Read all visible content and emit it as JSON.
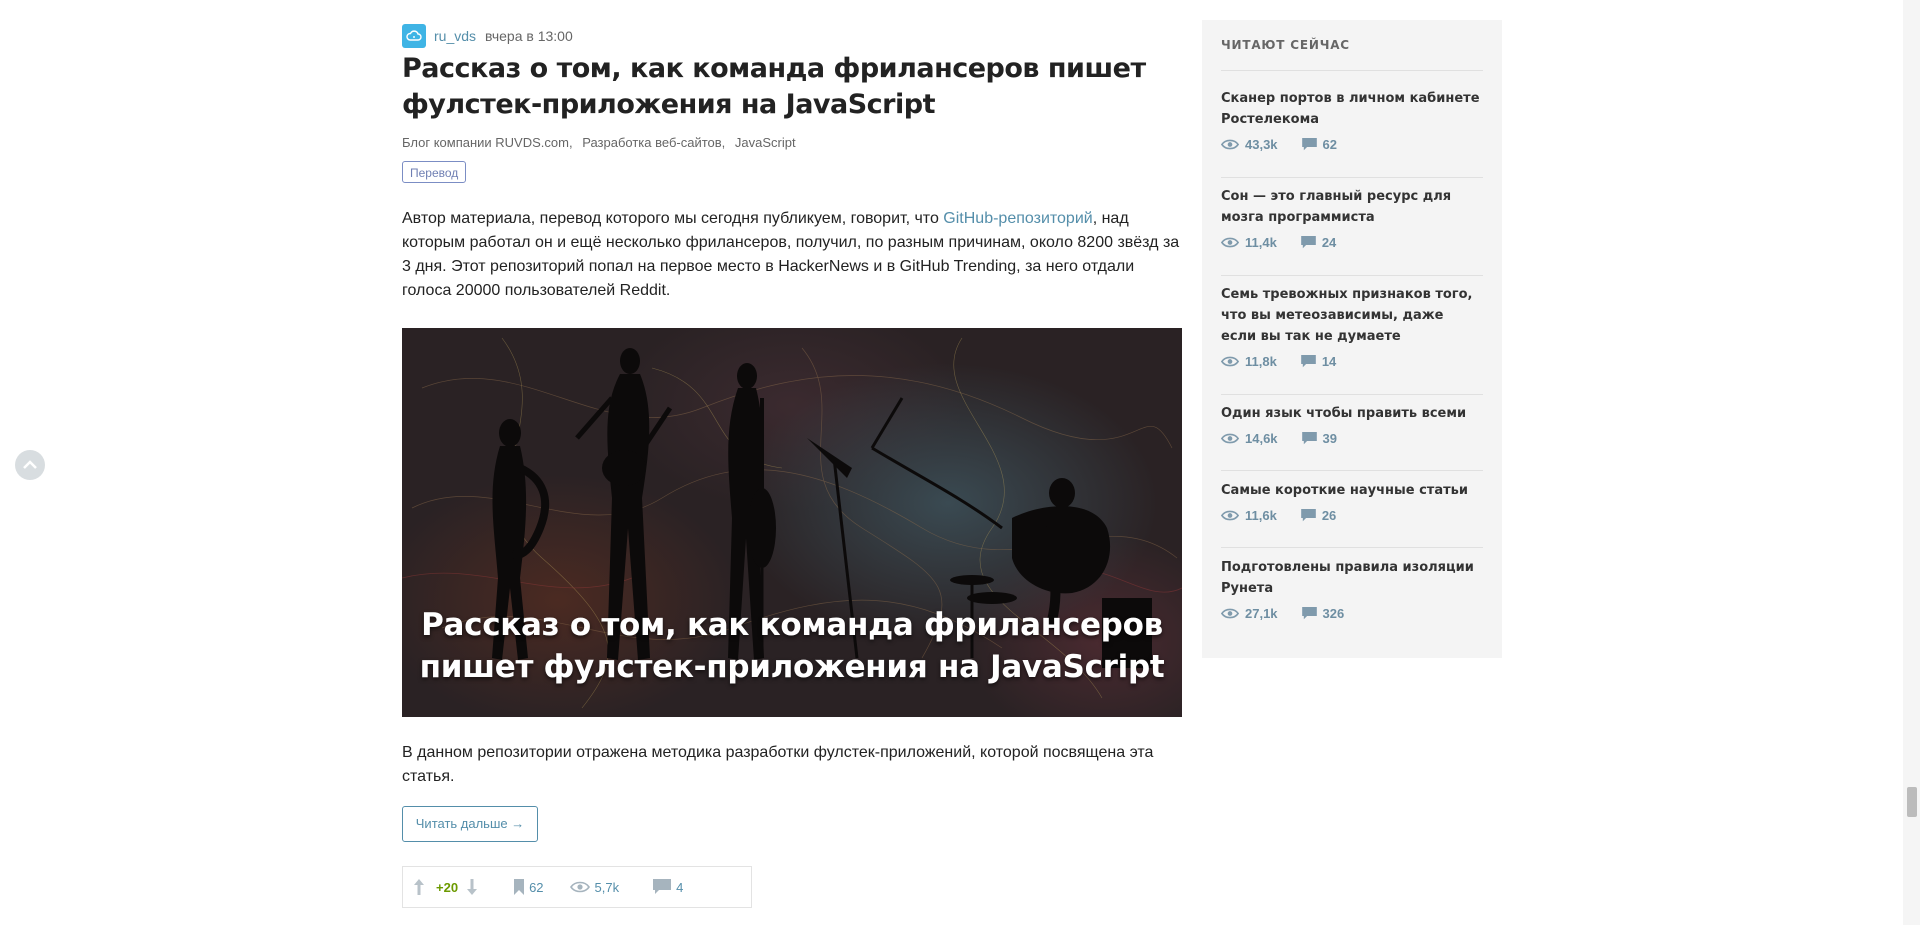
{
  "post": {
    "author": "ru_vds",
    "time": "вчера в 13:00",
    "title": "Рассказ о том, как команда фрилансеров пишет фулстек-приложения на JavaScript",
    "hubs": [
      "Блог компании RUVDS.com,",
      "Разработка веб-сайтов,",
      "JavaScript"
    ],
    "badge": "Перевод",
    "intro_before_link": "Автор материала, перевод которого мы сегодня публикуем, говорит, что ",
    "intro_link": "GitHub-репозиторий",
    "intro_after_link": ", над которым работал он и ещё несколько фрилансеров, получил, по разным причинам, около 8200 звёзд за 3 дня. Этот репозиторий попал на первое место в HackerNews и в GitHub Trending, за него отдали голоса 20000 пользователей Reddit.",
    "cover_caption": "Рассказ о том, как команда фрилансеров пишет фулстек-приложения на JavaScript",
    "after_cover": "В данном репозитории отражена методика разработки фулстек-приложений, которой посвящена эта статья.",
    "read_more": "Читать дальше →",
    "stats": {
      "rating": "+20",
      "bookmarks": "62",
      "views": "5,7k",
      "comments": "4"
    }
  },
  "sidebar": {
    "title": "ЧИТАЮТ СЕЙЧАС",
    "items": [
      {
        "title": "Сканер портов в личном кабинете Ростелекома",
        "views": "43,3k",
        "comments": "62"
      },
      {
        "title": "Сон — это главный ресурс для мозга программиста",
        "views": "11,4k",
        "comments": "24"
      },
      {
        "title": "Семь тревожных признаков того, что вы метеозависимы, даже если вы так не думаете",
        "views": "11,8k",
        "comments": "14"
      },
      {
        "title": "Один язык чтобы править всеми",
        "views": "14,6k",
        "comments": "39"
      },
      {
        "title": "Самые короткие научные статьи",
        "views": "11,6k",
        "comments": "26"
      },
      {
        "title": "Подготовлены правила изоляции Рунета",
        "views": "27,1k",
        "comments": "326"
      }
    ]
  },
  "colors": {
    "link": "#548eaa",
    "rating": "#6c9a00",
    "sidebar_bg": "#f4f4f4"
  }
}
